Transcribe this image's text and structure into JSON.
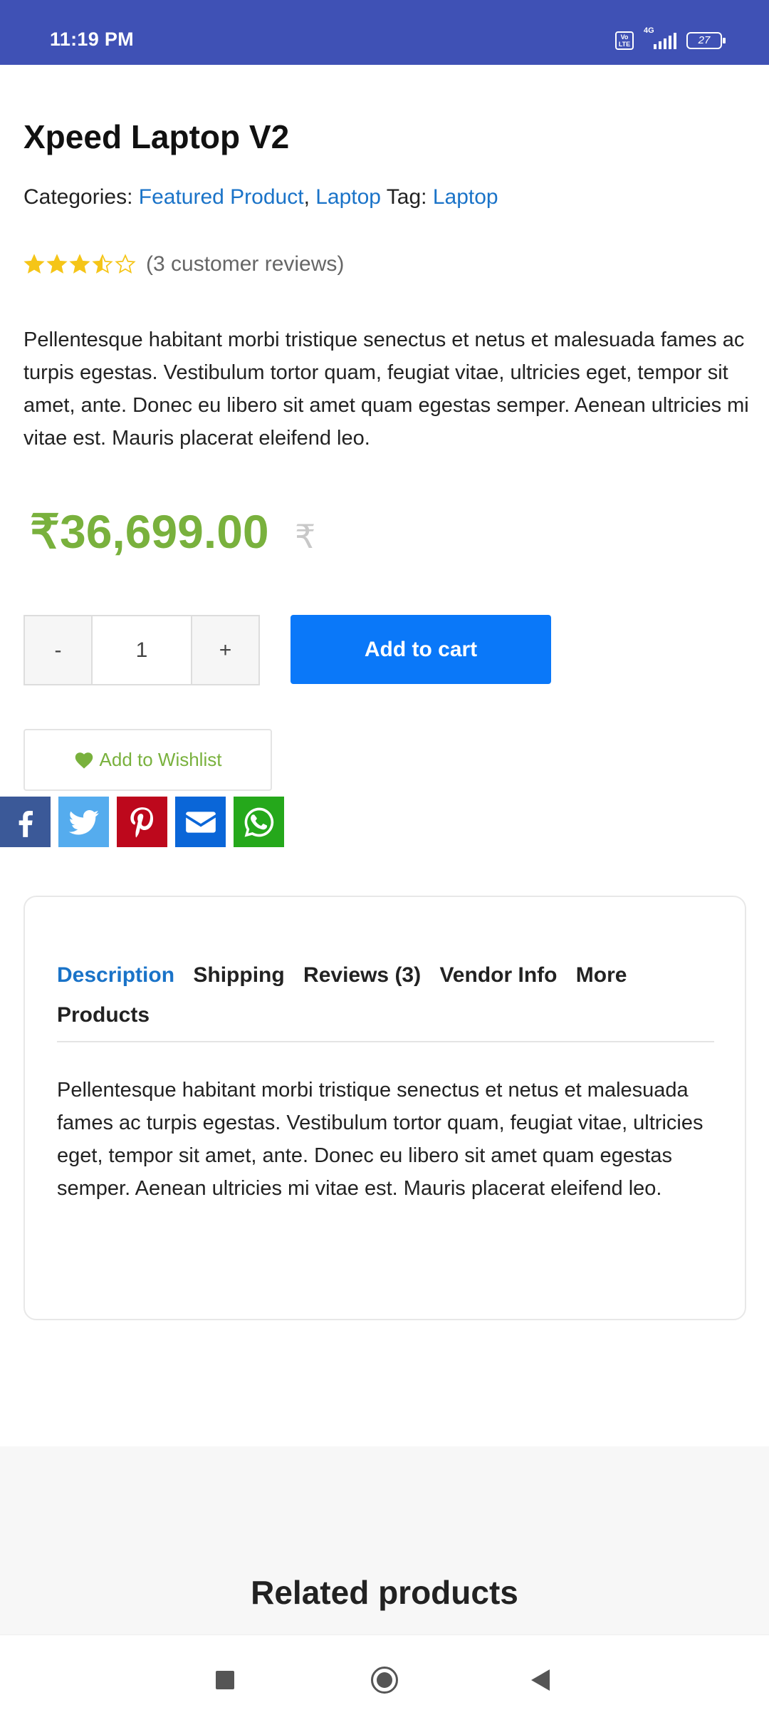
{
  "status_bar": {
    "time": "11:19 PM",
    "volte_label": "Vo LTE",
    "network": "4G",
    "battery": "27"
  },
  "product": {
    "title": "Xpeed Laptop V2",
    "categories_label": "Categories:",
    "categories": [
      "Featured Product",
      "Laptop"
    ],
    "tag_label": "Tag:",
    "tag": "Laptop",
    "rating": 3.5,
    "rating_max": 5,
    "review_count_text": "(3 customer reviews)",
    "description": "Pellentesque habitant morbi tristique senectus et netus et malesuada fames ac turpis egestas. Vestibulum tortor quam, feugiat vitae, ultricies eget, tempor sit amet, ante. Donec eu libero sit amet quam egestas semper. Aenean ultricies mi vitae est. Mauris placerat eleifend leo.",
    "price": "₹36,699.00",
    "price_currency_symbol": "₹"
  },
  "purchase": {
    "minus": "-",
    "quantity": "1",
    "plus": "+",
    "add_to_cart": "Add to cart",
    "add_to_wishlist": "Add to Wishlist"
  },
  "share": [
    {
      "name": "facebook",
      "icon": "facebook-icon",
      "color": "#3b5998"
    },
    {
      "name": "twitter",
      "icon": "twitter-icon",
      "color": "#55acee"
    },
    {
      "name": "pinterest",
      "icon": "pinterest-icon",
      "color": "#bd081c"
    },
    {
      "name": "email",
      "icon": "email-icon",
      "color": "#0a66d8"
    },
    {
      "name": "whatsapp",
      "icon": "whatsapp-icon",
      "color": "#25a81b"
    }
  ],
  "tabs": {
    "items": [
      "Description",
      "Shipping",
      "Reviews (3)",
      "Vendor Info",
      "More Products"
    ],
    "active": "Description",
    "content": "Pellentesque habitant morbi tristique senectus et netus et malesuada fames ac turpis egestas. Vestibulum tortor quam, feugiat vitae, ultricies eget, tempor sit amet, ante. Donec eu libero sit amet quam egestas semper. Aenean ultricies mi vitae est. Mauris placerat eleifend leo."
  },
  "related": {
    "title": "Related products"
  },
  "colors": {
    "status_bar": "#3f51b5",
    "link": "#1a73c8",
    "price": "#79b13d",
    "cart_button": "#0a78f9",
    "star": "#f5c518"
  }
}
